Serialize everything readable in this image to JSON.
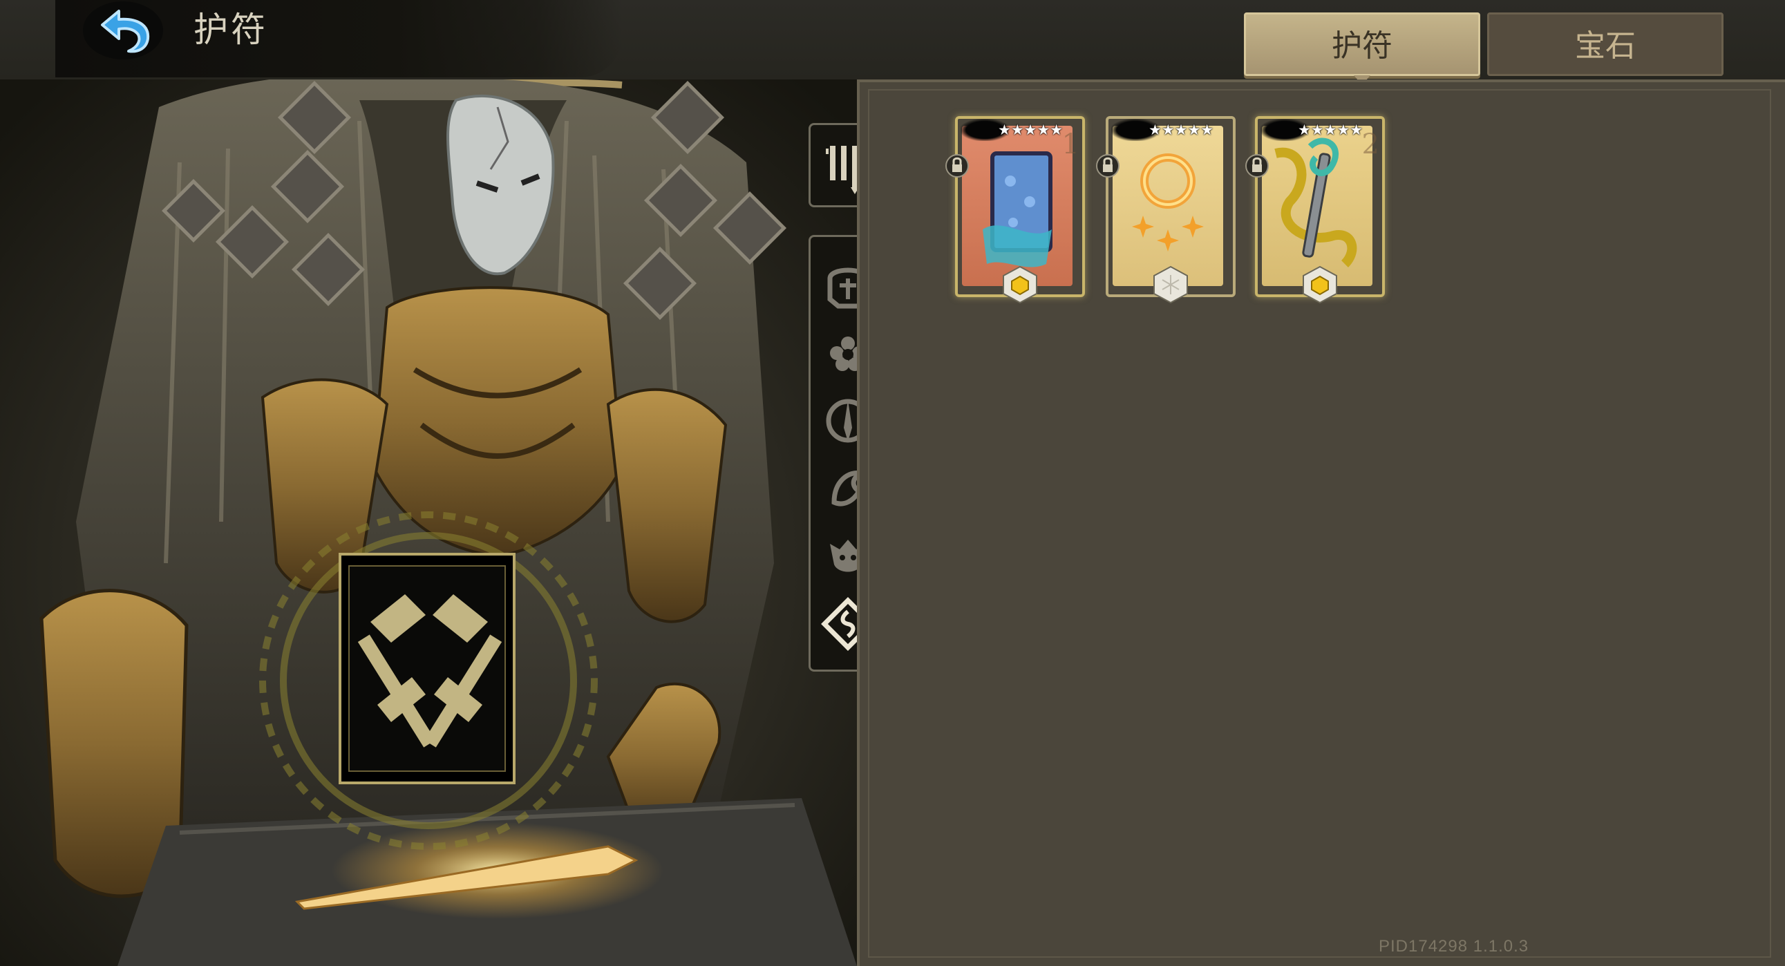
{
  "header": {
    "title": "护符",
    "back_icon": "back-arrow-icon"
  },
  "tabs": [
    {
      "label": "护符",
      "active": true
    },
    {
      "label": "宝石",
      "active": false
    }
  ],
  "colors": {
    "accent_gold": "#c9b56a",
    "panel_bg": "#4b463b",
    "tab_active_bg": "#b6a57e",
    "tab_inactive_bg": "#554c3e"
  },
  "categories": {
    "top_icon": "sort-icon",
    "items": [
      {
        "icon": "helmet-icon"
      },
      {
        "icon": "flower-icon"
      },
      {
        "icon": "dagger-icon"
      },
      {
        "icon": "bird-icon"
      },
      {
        "icon": "jester-mask-icon"
      },
      {
        "icon": "rune-diamond-icon",
        "selected": true
      }
    ]
  },
  "featured_charm": {
    "icon": "crossed-hammers-icon"
  },
  "charms": [
    {
      "stars": "★★★★★",
      "star_count": 5,
      "level": "1",
      "locked": true,
      "gem": "gold",
      "art": "blue-scroll-icon",
      "bg": "#d98466"
    },
    {
      "stars": "★★★★★",
      "star_count": 5,
      "level": "",
      "locked": true,
      "gem": "silver",
      "art": "fire-ring-icon",
      "bg": "#e8cf8c"
    },
    {
      "stars": "★★★★★",
      "star_count": 5,
      "level": "2",
      "locked": true,
      "gem": "gold",
      "art": "serpent-staff-icon",
      "bg": "#e6cf86"
    }
  ],
  "footer": {
    "version": "PID174298  1.1.0.3"
  }
}
